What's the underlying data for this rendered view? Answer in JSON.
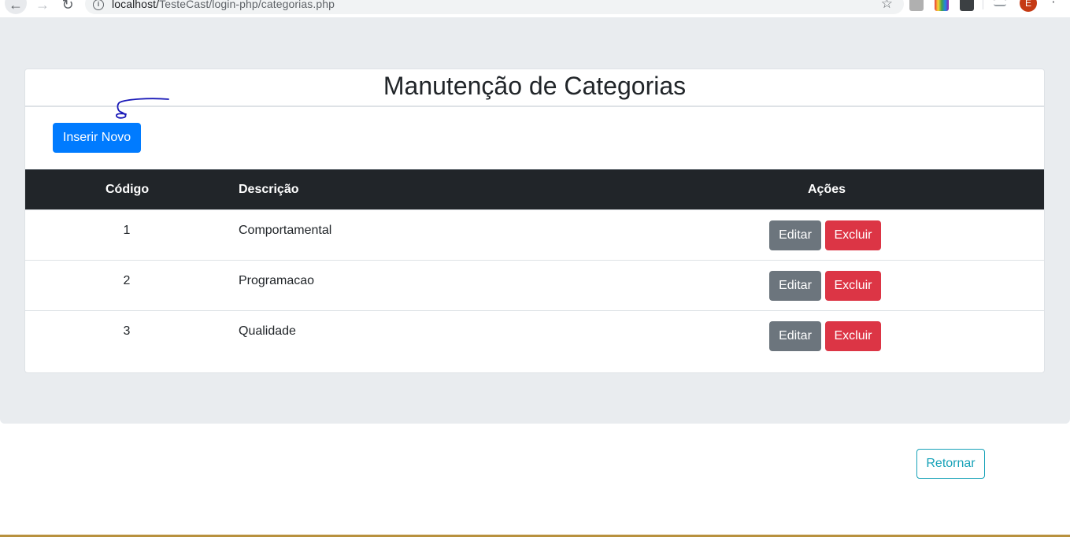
{
  "browser": {
    "url_host": "localhost/",
    "url_path": "TesteCast/login-php/categorias.php",
    "info_icon": "i",
    "avatar_letter": "E"
  },
  "page": {
    "title": "Manutenção de Categorias",
    "insert_label": "Inserir Novo",
    "return_label": "Retornar"
  },
  "table": {
    "headers": {
      "code": "Código",
      "description": "Descrição",
      "actions": "Ações"
    },
    "rows": [
      {
        "code": "1",
        "description": "Comportamental",
        "edit": "Editar",
        "delete": "Excluir"
      },
      {
        "code": "2",
        "description": "Programacao",
        "edit": "Editar",
        "delete": "Excluir"
      },
      {
        "code": "3",
        "description": "Qualidade",
        "edit": "Editar",
        "delete": "Excluir"
      }
    ]
  },
  "colors": {
    "primary": "#007bff",
    "secondary": "#6c757d",
    "danger": "#dc3545",
    "info": "#17a2b8",
    "table_header": "#212529",
    "jumbotron": "#e9ecef",
    "annotation": "#1a1ab8"
  }
}
